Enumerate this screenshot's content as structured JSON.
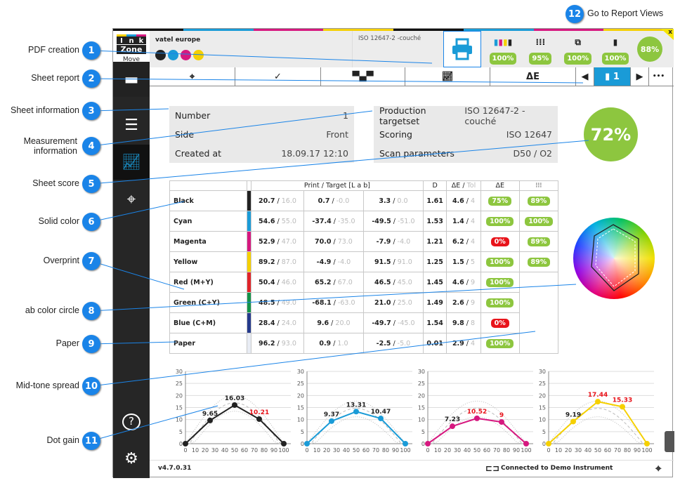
{
  "callouts": [
    {
      "n": "1",
      "label": "PDF creation"
    },
    {
      "n": "2",
      "label": "Sheet report"
    },
    {
      "n": "3",
      "label": "Sheet information"
    },
    {
      "n": "4",
      "label": "Measurement information"
    },
    {
      "n": "5",
      "label": "Sheet score"
    },
    {
      "n": "6",
      "label": "Solid color"
    },
    {
      "n": "7",
      "label": "Overprint"
    },
    {
      "n": "8",
      "label": "ab color circle"
    },
    {
      "n": "9",
      "label": "Paper"
    },
    {
      "n": "10",
      "label": "Mid-tone spread"
    },
    {
      "n": "11",
      "label": "Dot gain"
    },
    {
      "n": "12",
      "label": "Go to Report Views"
    }
  ],
  "header": {
    "logo_letters": [
      "I",
      "n",
      "k"
    ],
    "logo_word": "Zone",
    "logo_sub": "Move",
    "customer": "vatel europe",
    "standard": "ISO 12647-2 -couché",
    "ink_colors": [
      "#222222",
      "#1a9bd7",
      "#d6187f",
      "#f5d000"
    ],
    "scores": [
      {
        "icon": "cmyk-bars-icon",
        "value": "100%"
      },
      {
        "icon": "dot-grid-icon",
        "value": "95%"
      },
      {
        "icon": "overprint-icon",
        "value": "100%"
      },
      {
        "icon": "paper-icon",
        "value": "100%"
      }
    ],
    "total": "88%",
    "close": "x"
  },
  "toolbar": {
    "page": "1",
    "more": "•••",
    "delta_e": "ΔE"
  },
  "sheet_info": [
    {
      "k": "Number",
      "v": "1"
    },
    {
      "k": "Side",
      "v": "Front"
    },
    {
      "k": "Created at",
      "v": "18.09.17 12:10"
    }
  ],
  "measurement_info": [
    {
      "k": "Production targetset",
      "v": "ISO 12647-2 -couché"
    },
    {
      "k": "Scoring",
      "v": "ISO 12647"
    },
    {
      "k": "Scan parameters",
      "v": "D50 / O2"
    }
  ],
  "sheet_score": "72%",
  "table": {
    "headers": {
      "lab": "Print / Target [L a b]",
      "d": "D",
      "de": "ΔE",
      "tol": "Tol",
      "de_col": "ΔE",
      "grid_col": "⁝⁝⁝"
    },
    "rows": [
      {
        "name": "Black",
        "color": "#222222",
        "L": [
          "20.7",
          "16.0"
        ],
        "a": [
          "0.7",
          "-0.0"
        ],
        "b": [
          "3.3",
          "0.0"
        ],
        "D": "1.61",
        "dE": [
          "4.6",
          "4"
        ],
        "s1": "75%",
        "s1ok": true,
        "s2": "89%"
      },
      {
        "name": "Cyan",
        "color": "#1a9bd7",
        "L": [
          "54.6",
          "55.0"
        ],
        "a": [
          "-37.4",
          "-35.0"
        ],
        "b": [
          "-49.5",
          "-51.0"
        ],
        "D": "1.53",
        "dE": [
          "1.4",
          "4"
        ],
        "s1": "100%",
        "s1ok": true,
        "s2": "100%"
      },
      {
        "name": "Magenta",
        "color": "#d6187f",
        "L": [
          "52.9",
          "47.0"
        ],
        "a": [
          "70.0",
          "73.0"
        ],
        "b": [
          "-7.9",
          "-4.0"
        ],
        "D": "1.21",
        "dE": [
          "6.2",
          "4"
        ],
        "s1": "0%",
        "s1ok": false,
        "s2": "89%"
      },
      {
        "name": "Yellow",
        "color": "#f5d000",
        "L": [
          "89.2",
          "87.0"
        ],
        "a": [
          "-4.9",
          "-4.0"
        ],
        "b": [
          "91.5",
          "91.0"
        ],
        "D": "1.25",
        "dE": [
          "1.5",
          "5"
        ],
        "s1": "100%",
        "s1ok": true,
        "s2": "89%"
      },
      {
        "name": "Red (M+Y)",
        "color": "#e0242a",
        "L": [
          "50.4",
          "46.0"
        ],
        "a": [
          "65.2",
          "67.0"
        ],
        "b": [
          "46.5",
          "45.0"
        ],
        "D": "1.45",
        "dE": [
          "4.6",
          "9"
        ],
        "s1": "100%",
        "s1ok": true,
        "s2": ""
      },
      {
        "name": "Green (C+Y)",
        "color": "#14934a",
        "L": [
          "48.5",
          "49.0"
        ],
        "a": [
          "-68.1",
          "-63.0"
        ],
        "b": [
          "21.0",
          "25.0"
        ],
        "D": "1.49",
        "dE": [
          "2.6",
          "9"
        ],
        "s1": "100%",
        "s1ok": true,
        "s2": ""
      },
      {
        "name": "Blue (C+M)",
        "color": "#253a8c",
        "L": [
          "28.4",
          "24.0"
        ],
        "a": [
          "9.6",
          "20.0"
        ],
        "b": [
          "-49.7",
          "-45.0"
        ],
        "D": "1.54",
        "dE": [
          "9.8",
          "8"
        ],
        "s1": "0%",
        "s1ok": false,
        "s2": ""
      },
      {
        "name": "Paper",
        "color": "#e8ecf4",
        "L": [
          "96.2",
          "93.0"
        ],
        "a": [
          "0.9",
          "1.0"
        ],
        "b": [
          "-2.5",
          "-5.0"
        ],
        "D": "0.01",
        "dE": [
          "2.9",
          "4"
        ],
        "s1": "100%",
        "s1ok": true,
        "s2": ""
      }
    ]
  },
  "chart_data": [
    {
      "type": "line",
      "x": [
        0,
        25,
        50,
        75,
        100
      ],
      "values": [
        0,
        9.65,
        16.03,
        10.21,
        0
      ],
      "labels": [
        "9.65",
        "16.03",
        "10.21"
      ],
      "label_out_of_tol": [
        false,
        false,
        true
      ],
      "color": "#222222",
      "ylim": [
        0,
        30
      ],
      "yticks": [
        0,
        5,
        10,
        15,
        20,
        25,
        30
      ],
      "xticks": [
        0,
        10,
        20,
        30,
        40,
        50,
        60,
        70,
        80,
        90,
        100
      ],
      "grid": true
    },
    {
      "type": "line",
      "x": [
        0,
        25,
        50,
        75,
        100
      ],
      "values": [
        0,
        9.37,
        13.31,
        10.47,
        0
      ],
      "labels": [
        "9.37",
        "13.31",
        "10.47"
      ],
      "label_out_of_tol": [
        false,
        false,
        false
      ],
      "color": "#1a9bd7",
      "ylim": [
        0,
        30
      ],
      "yticks": [
        0,
        5,
        10,
        15,
        20,
        25,
        30
      ],
      "xticks": [
        0,
        10,
        20,
        30,
        40,
        50,
        60,
        70,
        80,
        90,
        100
      ],
      "grid": true
    },
    {
      "type": "line",
      "x": [
        0,
        25,
        50,
        75,
        100
      ],
      "values": [
        0,
        7.23,
        10.52,
        9,
        0
      ],
      "labels": [
        "7.23",
        "10.52",
        "9"
      ],
      "label_out_of_tol": [
        false,
        true,
        true
      ],
      "color": "#d6187f",
      "ylim": [
        0,
        30
      ],
      "yticks": [
        0,
        5,
        10,
        15,
        20,
        25,
        30
      ],
      "xticks": [
        0,
        10,
        20,
        30,
        40,
        50,
        60,
        70,
        80,
        90,
        100
      ],
      "grid": true
    },
    {
      "type": "line",
      "x": [
        0,
        25,
        50,
        75,
        100
      ],
      "values": [
        0,
        9.19,
        17.44,
        15.33,
        0
      ],
      "labels": [
        "9.19",
        "17.44",
        "15.33"
      ],
      "label_out_of_tol": [
        false,
        true,
        true
      ],
      "color": "#f5d000",
      "ylim": [
        0,
        30
      ],
      "yticks": [
        0,
        5,
        10,
        15,
        20,
        25,
        30
      ],
      "xticks": [
        0,
        10,
        20,
        30,
        40,
        50,
        60,
        70,
        80,
        90,
        100
      ],
      "grid": true
    }
  ],
  "footer": {
    "version": "v4.7.0.31",
    "status": "Connected to Demo Instrument"
  }
}
